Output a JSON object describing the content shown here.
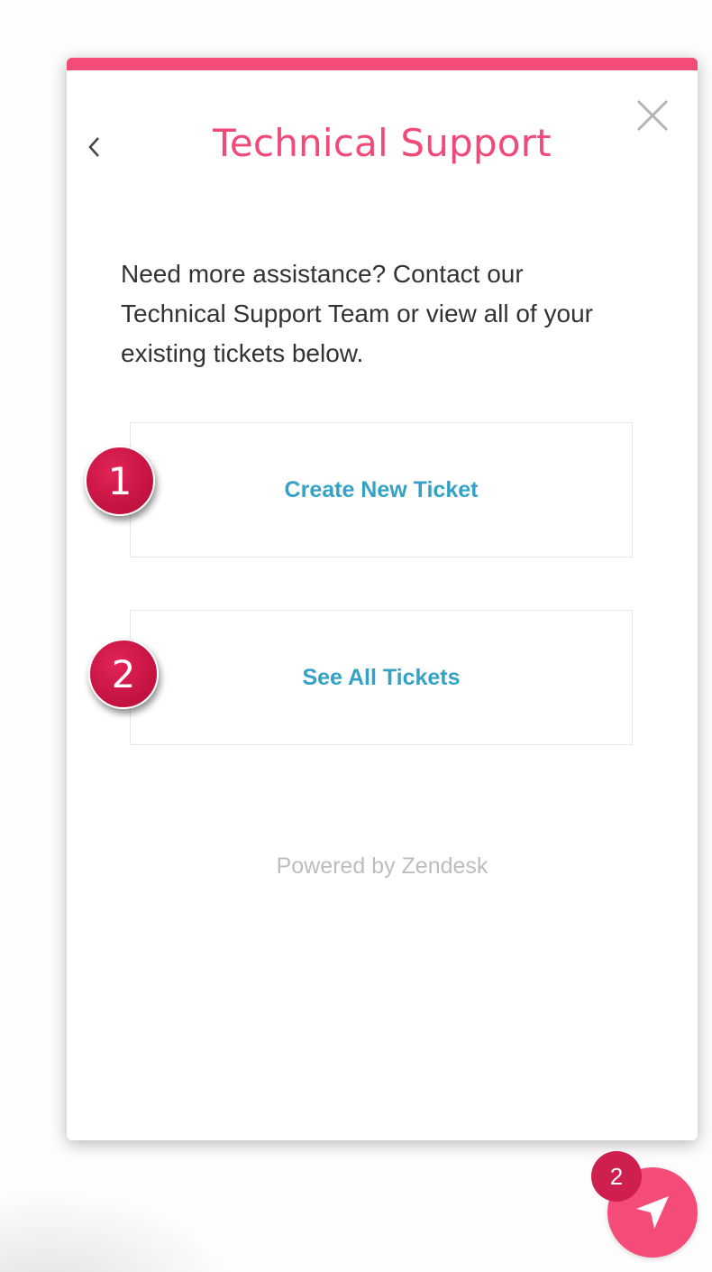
{
  "widget": {
    "title": "Technical Support",
    "description": "Need more assistance? Contact our Technical Support Team or view all of your existing tickets below.",
    "buttons": {
      "create_ticket": "Create New Ticket",
      "see_all_tickets": "See All Tickets"
    },
    "footer": "Powered by Zendesk",
    "icons": {
      "close": "close-icon",
      "back": "chevron-left-icon"
    }
  },
  "annotations": {
    "step_1": "1",
    "step_2": "2"
  },
  "launcher": {
    "notification_count": "2",
    "icon": "launcher-arrow-icon"
  },
  "colors": {
    "accent": "#f54b78",
    "title": "#f24a78",
    "link": "#35a1c4",
    "badge": "#cf1f4e",
    "footer": "#bdbdbd"
  }
}
